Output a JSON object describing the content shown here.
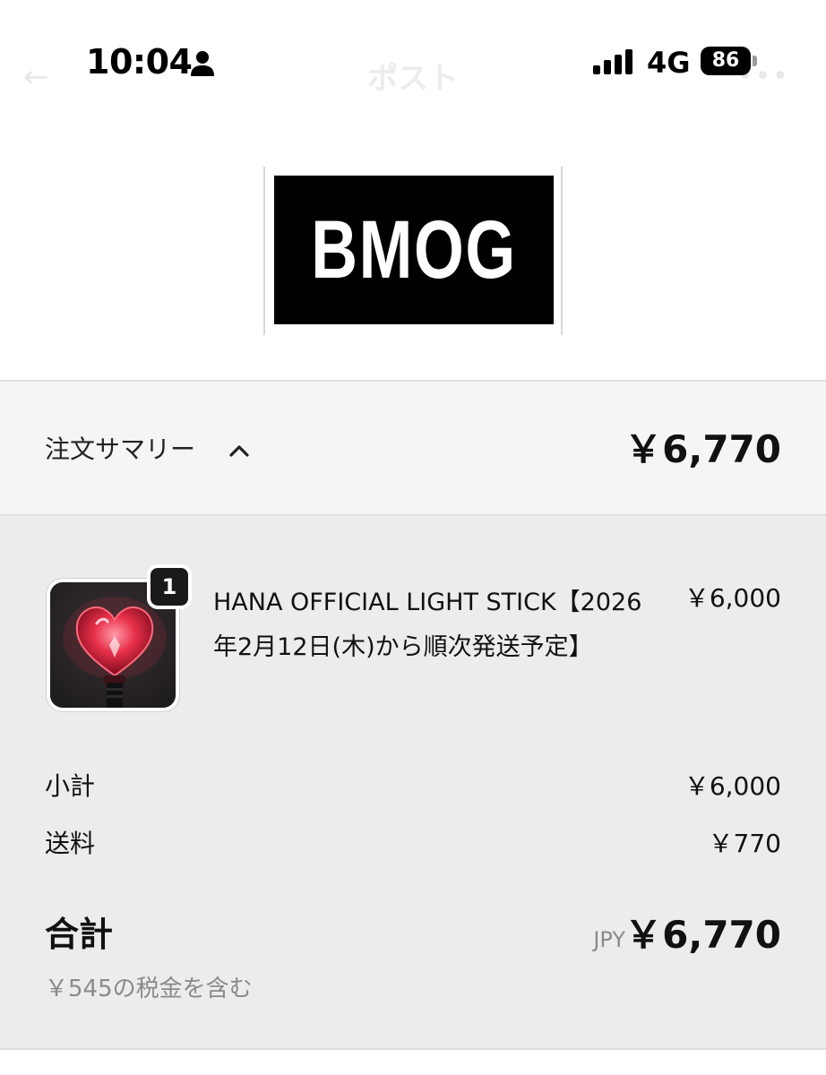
{
  "status_bar": {
    "time": "10:04",
    "network": "4G",
    "battery": "86",
    "icons": [
      "person-icon",
      "signal-icon"
    ]
  },
  "nav": {
    "title": "ポスト",
    "back_icon": "arrow-left-icon",
    "more_icon": "more-icon"
  },
  "brand": {
    "logo_text": "BMOG"
  },
  "summary": {
    "label": "注文サマリー",
    "toggle_icon": "chevron-up-icon",
    "total": "￥6,770"
  },
  "order": {
    "items": [
      {
        "name": "HANA OFFICIAL LIGHT STICK【2026年2月12日(木)から順次発送予定】",
        "price": "￥6,000",
        "quantity": "1",
        "image": "heart-light-stick"
      }
    ],
    "subtotal_label": "小計",
    "subtotal_value": "￥6,000",
    "shipping_label": "送料",
    "shipping_value": "￥770",
    "total_label": "合計",
    "currency": "JPY",
    "total_value": "￥6,770",
    "tax_note": "￥545の税金を含む"
  }
}
